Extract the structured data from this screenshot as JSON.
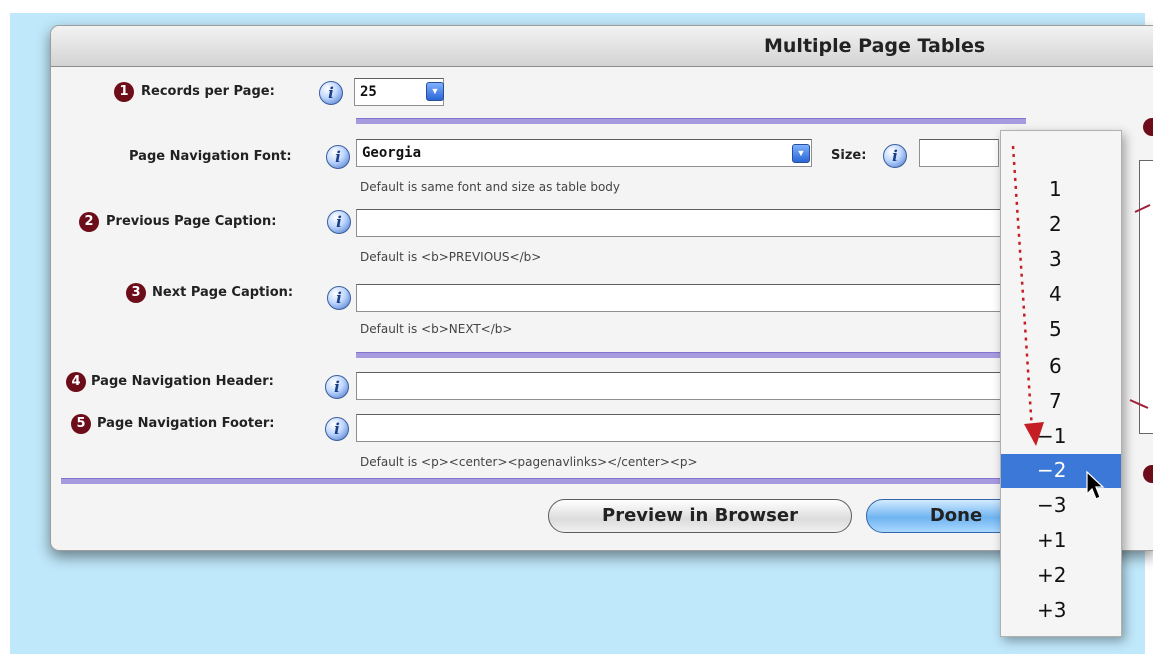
{
  "window": {
    "title": "Multiple Page Tables"
  },
  "colors": {
    "badge": "#6e0d1a",
    "separator": "#a79be0",
    "selection": "#3b78d8",
    "desktop": "#bfe8fa",
    "arrow": "#c41e24"
  },
  "records": {
    "label": "Records per Page:",
    "badge": "1",
    "value": "25"
  },
  "font": {
    "label": "Page Navigation Font:",
    "value": "Georgia",
    "size_label": "Size:",
    "size_value": "",
    "hint": "Default is same font and size as table body"
  },
  "previous": {
    "label": "Previous Page Caption:",
    "badge": "2",
    "value": "",
    "hint": "Default is <b>PREVIOUS</b>"
  },
  "next": {
    "label": "Next Page Caption:",
    "badge": "3",
    "value": "",
    "hint": "Default is <b>NEXT</b>"
  },
  "header": {
    "label": "Page Navigation Header:",
    "badge": "4",
    "value": ""
  },
  "footer": {
    "label": "Page Navigation Footer:",
    "badge": "5",
    "value": "",
    "hint": "Default is <p><center><pagenavlinks></center><p>"
  },
  "buttons": {
    "preview": "Preview in Browser",
    "done": "Done"
  },
  "size_menu": {
    "items": [
      "1",
      "2",
      "3",
      "4",
      "5",
      "6",
      "7",
      "−1",
      "−2",
      "−3",
      "+1",
      "+2",
      "+3"
    ],
    "selected_index": 8
  },
  "info_icon": "i"
}
